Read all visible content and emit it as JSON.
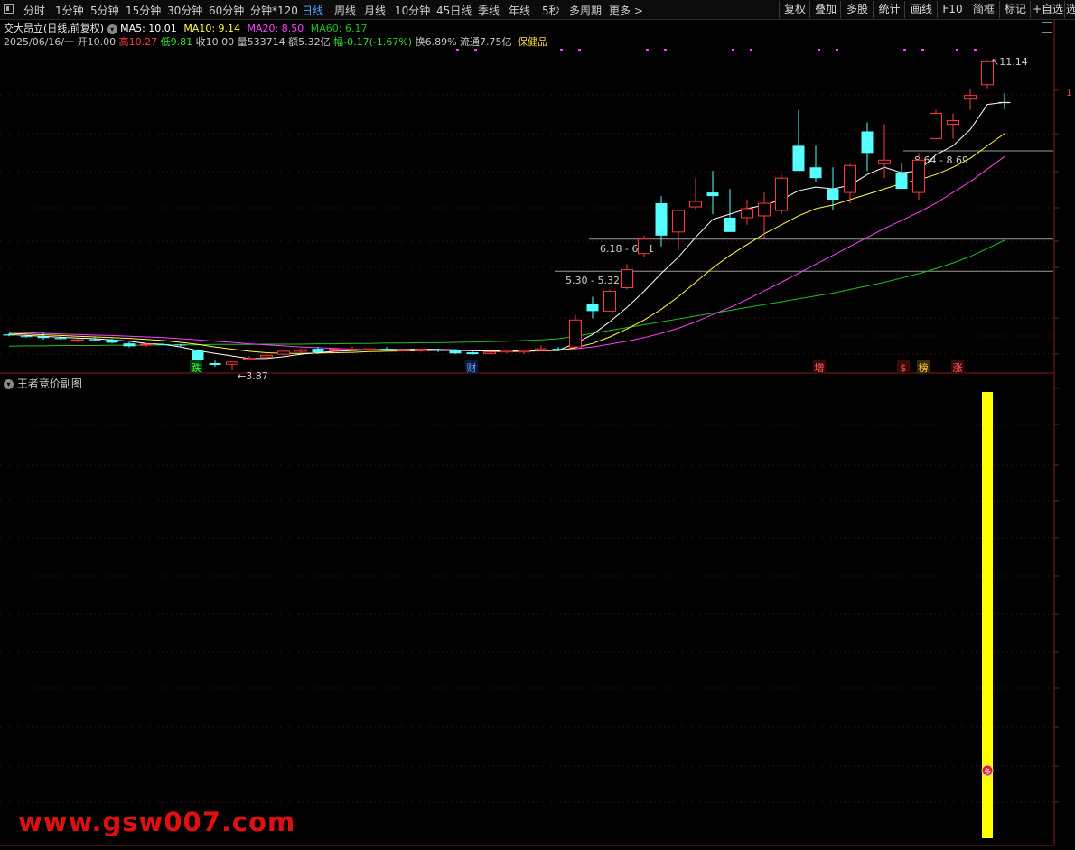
{
  "toolbar": {
    "periods": [
      "分时",
      "1分钟",
      "5分钟",
      "15分钟",
      "30分钟",
      "60分钟",
      "分钟*120",
      "日线",
      "周线",
      "月线",
      "10分钟",
      "45日线",
      "季线",
      "年线",
      "5秒",
      "多周期",
      "更多 >"
    ],
    "active_period": "日线",
    "right_buttons": [
      "复权",
      "叠加",
      "多股",
      "统计",
      "画线",
      "F10",
      "简框",
      "标记",
      "+自选",
      "选"
    ]
  },
  "header": {
    "stock_title": "交大昂立(日线,前复权)",
    "ma5": "MA5: 10.01",
    "ma10": "MA10: 9.14",
    "ma20": "MA20: 8.50",
    "ma60": "MA60: 6.17",
    "date": "2025/06/16/一",
    "open_label": "开",
    "open": "10.00",
    "high_label": "高",
    "high": "10.27",
    "low_label": "低",
    "low": "9.81",
    "close_label": "收",
    "close": "10.00",
    "vol_label": "量",
    "vol": "533714",
    "amt_label": "额",
    "amt": "5.32亿",
    "chg_label": "幅",
    "chg": "-0.17(-1.67%)",
    "turn_label": "换",
    "turn": "6.89%",
    "float_label": "流通",
    "float_cap": "7.75亿",
    "sector": "保健品"
  },
  "colors": {
    "up": "#ff3a3a",
    "down": "#54ffff",
    "ma5": "#ffffff",
    "ma10": "#ffff40",
    "ma20": "#ff40ff",
    "ma60": "#20c020",
    "marker": "#ff40ff",
    "bar": "#ffff00"
  },
  "annotations": {
    "max_price": "11.14",
    "min_price": "3.87",
    "axis_tick": "1",
    "level1": "8.64 - 8.69",
    "level2": "6.18 - 6.21",
    "level3": "5.30 - 5.32"
  },
  "signals": [
    "跌",
    "财",
    "增",
    "$",
    "榜",
    "涨"
  ],
  "sub_chart": {
    "title": "王者竞价副图",
    "marker_glyph": "多"
  },
  "watermark": "www.gsw007.com",
  "chart_data": {
    "type": "candlestick",
    "candles": [
      {
        "o": 3.55,
        "h": 3.58,
        "l": 3.5,
        "c": 3.52
      },
      {
        "o": 3.5,
        "h": 3.55,
        "l": 3.46,
        "c": 3.48
      },
      {
        "o": 3.49,
        "h": 3.6,
        "l": 3.4,
        "c": 3.45
      },
      {
        "o": 3.45,
        "h": 3.5,
        "l": 3.4,
        "c": 3.42
      },
      {
        "o": 3.38,
        "h": 3.42,
        "l": 3.34,
        "c": 3.4
      },
      {
        "o": 3.41,
        "h": 3.46,
        "l": 3.38,
        "c": 3.4
      },
      {
        "o": 3.4,
        "h": 3.44,
        "l": 3.3,
        "c": 3.32
      },
      {
        "o": 3.3,
        "h": 3.34,
        "l": 3.19,
        "c": 3.22
      },
      {
        "o": 3.26,
        "h": 3.3,
        "l": 3.2,
        "c": 3.28
      },
      {
        "o": 3.28,
        "h": 3.3,
        "l": 3.24,
        "c": 3.27
      },
      {
        "o": 3.27,
        "h": 3.28,
        "l": 3.22,
        "c": 3.25
      },
      {
        "o": 3.1,
        "h": 3.14,
        "l": 2.8,
        "c": 2.85
      },
      {
        "o": 2.75,
        "h": 2.82,
        "l": 2.65,
        "c": 2.7
      },
      {
        "o": 2.72,
        "h": 2.8,
        "l": 2.55,
        "c": 2.78
      },
      {
        "o": 2.85,
        "h": 2.95,
        "l": 2.82,
        "c": 2.88
      },
      {
        "o": 2.92,
        "h": 3.0,
        "l": 2.88,
        "c": 2.97
      },
      {
        "o": 3.0,
        "h": 3.1,
        "l": 2.96,
        "c": 3.08
      },
      {
        "o": 3.08,
        "h": 3.16,
        "l": 3.04,
        "c": 3.12
      },
      {
        "o": 3.15,
        "h": 3.2,
        "l": 3.0,
        "c": 3.05
      },
      {
        "o": 3.1,
        "h": 3.18,
        "l": 3.04,
        "c": 3.14
      },
      {
        "o": 3.12,
        "h": 3.22,
        "l": 3.08,
        "c": 3.14
      },
      {
        "o": 3.12,
        "h": 3.16,
        "l": 3.05,
        "c": 3.15
      },
      {
        "o": 3.15,
        "h": 3.2,
        "l": 3.1,
        "c": 3.14
      },
      {
        "o": 3.12,
        "h": 3.16,
        "l": 3.08,
        "c": 3.12
      },
      {
        "o": 3.1,
        "h": 3.16,
        "l": 3.06,
        "c": 3.14
      },
      {
        "o": 3.12,
        "h": 3.16,
        "l": 3.06,
        "c": 3.1
      },
      {
        "o": 3.1,
        "h": 3.14,
        "l": 3.0,
        "c": 3.02
      },
      {
        "o": 3.05,
        "h": 3.08,
        "l": 2.98,
        "c": 3.0
      },
      {
        "o": 3.02,
        "h": 3.08,
        "l": 3.0,
        "c": 3.06
      },
      {
        "o": 3.06,
        "h": 3.12,
        "l": 3.02,
        "c": 3.1
      },
      {
        "o": 3.06,
        "h": 3.12,
        "l": 3.0,
        "c": 3.1
      },
      {
        "o": 3.1,
        "h": 3.25,
        "l": 3.08,
        "c": 3.15
      },
      {
        "o": 3.15,
        "h": 3.2,
        "l": 3.1,
        "c": 3.12
      },
      {
        "o": 3.2,
        "h": 4.1,
        "l": 3.2,
        "c": 3.95
      },
      {
        "o": 4.4,
        "h": 4.6,
        "l": 4.0,
        "c": 4.2
      },
      {
        "o": 4.2,
        "h": 4.8,
        "l": 4.2,
        "c": 4.75
      },
      {
        "o": 4.85,
        "h": 5.5,
        "l": 4.8,
        "c": 5.35
      },
      {
        "o": 5.8,
        "h": 6.3,
        "l": 5.7,
        "c": 6.2
      },
      {
        "o": 7.2,
        "h": 7.4,
        "l": 6.0,
        "c": 6.3
      },
      {
        "o": 6.4,
        "h": 7.0,
        "l": 5.9,
        "c": 7.0
      },
      {
        "o": 7.1,
        "h": 7.9,
        "l": 7.0,
        "c": 7.25
      },
      {
        "o": 7.5,
        "h": 8.1,
        "l": 6.9,
        "c": 7.4
      },
      {
        "o": 6.8,
        "h": 7.6,
        "l": 6.5,
        "c": 6.4
      },
      {
        "o": 6.8,
        "h": 7.3,
        "l": 6.6,
        "c": 7.05
      },
      {
        "o": 6.85,
        "h": 7.5,
        "l": 6.2,
        "c": 7.2
      },
      {
        "o": 7.0,
        "h": 8.0,
        "l": 6.9,
        "c": 7.9
      },
      {
        "o": 8.8,
        "h": 9.8,
        "l": 8.4,
        "c": 8.1
      },
      {
        "o": 8.2,
        "h": 8.8,
        "l": 7.8,
        "c": 7.9
      },
      {
        "o": 7.6,
        "h": 8.2,
        "l": 7.0,
        "c": 7.3
      },
      {
        "o": 7.5,
        "h": 8.3,
        "l": 7.2,
        "c": 8.25
      },
      {
        "o": 9.2,
        "h": 9.45,
        "l": 8.1,
        "c": 8.6
      },
      {
        "o": 8.3,
        "h": 9.4,
        "l": 7.9,
        "c": 8.4
      },
      {
        "o": 8.05,
        "h": 8.3,
        "l": 7.6,
        "c": 7.6
      },
      {
        "o": 7.5,
        "h": 8.6,
        "l": 7.3,
        "c": 8.4
      },
      {
        "o": 9.0,
        "h": 9.8,
        "l": 9.0,
        "c": 9.7
      },
      {
        "o": 9.4,
        "h": 9.7,
        "l": 9.0,
        "c": 9.5
      },
      {
        "o": 10.1,
        "h": 10.4,
        "l": 9.8,
        "c": 10.2
      },
      {
        "o": 10.5,
        "h": 11.2,
        "l": 10.4,
        "c": 11.14
      },
      {
        "o": 10.02,
        "h": 10.27,
        "l": 9.81,
        "c": 10.0
      }
    ],
    "ma5": [
      3.55,
      3.52,
      3.5,
      3.47,
      3.45,
      3.43,
      3.4,
      3.36,
      3.3,
      3.27,
      3.2,
      3.1,
      3.02,
      2.95,
      2.88,
      2.88,
      2.93,
      3.0,
      3.04,
      3.08,
      3.1,
      3.12,
      3.13,
      3.13,
      3.14,
      3.13,
      3.12,
      3.1,
      3.08,
      3.07,
      3.08,
      3.09,
      3.11,
      3.3,
      3.55,
      3.9,
      4.3,
      4.75,
      5.25,
      5.7,
      6.25,
      6.75,
      6.9,
      7.05,
      7.15,
      7.3,
      7.55,
      7.65,
      7.6,
      7.7,
      8.0,
      8.2,
      8.05,
      8.1,
      8.55,
      8.8,
      9.25,
      9.95,
      10.01
    ],
    "ma10": [
      3.58,
      3.56,
      3.54,
      3.52,
      3.5,
      3.48,
      3.46,
      3.44,
      3.41,
      3.38,
      3.33,
      3.27,
      3.2,
      3.14,
      3.08,
      3.04,
      3.02,
      3.02,
      3.03,
      3.04,
      3.05,
      3.07,
      3.08,
      3.09,
      3.1,
      3.11,
      3.11,
      3.1,
      3.1,
      3.1,
      3.1,
      3.1,
      3.1,
      3.18,
      3.3,
      3.48,
      3.7,
      3.95,
      4.25,
      4.6,
      5.0,
      5.4,
      5.75,
      6.05,
      6.35,
      6.6,
      6.85,
      7.05,
      7.15,
      7.3,
      7.45,
      7.6,
      7.75,
      7.85,
      8.0,
      8.2,
      8.45,
      8.8,
      9.14
    ],
    "ma20": [
      3.62,
      3.6,
      3.58,
      3.56,
      3.55,
      3.53,
      3.52,
      3.5,
      3.48,
      3.46,
      3.43,
      3.4,
      3.36,
      3.33,
      3.29,
      3.26,
      3.23,
      3.2,
      3.18,
      3.16,
      3.14,
      3.12,
      3.11,
      3.1,
      3.1,
      3.1,
      3.1,
      3.09,
      3.09,
      3.09,
      3.09,
      3.1,
      3.12,
      3.15,
      3.2,
      3.28,
      3.36,
      3.46,
      3.58,
      3.72,
      3.9,
      4.1,
      4.3,
      4.52,
      4.76,
      5.0,
      5.25,
      5.5,
      5.75,
      6.0,
      6.25,
      6.5,
      6.72,
      6.95,
      7.2,
      7.5,
      7.8,
      8.15,
      8.5
    ],
    "ma60": [
      3.22,
      3.23,
      3.23,
      3.24,
      3.24,
      3.24,
      3.25,
      3.25,
      3.25,
      3.26,
      3.26,
      3.26,
      3.27,
      3.27,
      3.27,
      3.28,
      3.28,
      3.28,
      3.29,
      3.29,
      3.3,
      3.3,
      3.31,
      3.31,
      3.32,
      3.32,
      3.33,
      3.34,
      3.35,
      3.36,
      3.38,
      3.4,
      3.43,
      3.5,
      3.58,
      3.66,
      3.74,
      3.82,
      3.9,
      3.98,
      4.06,
      4.14,
      4.22,
      4.3,
      4.38,
      4.46,
      4.54,
      4.62,
      4.7,
      4.8,
      4.9,
      5.0,
      5.12,
      5.24,
      5.38,
      5.54,
      5.72,
      5.94,
      6.17
    ],
    "price_levels": [
      8.66,
      6.2,
      5.31
    ],
    "ylim": [
      2.6,
      11.6
    ],
    "sub_series": {
      "name": "王者竞价副图",
      "signal_index": 57
    }
  }
}
